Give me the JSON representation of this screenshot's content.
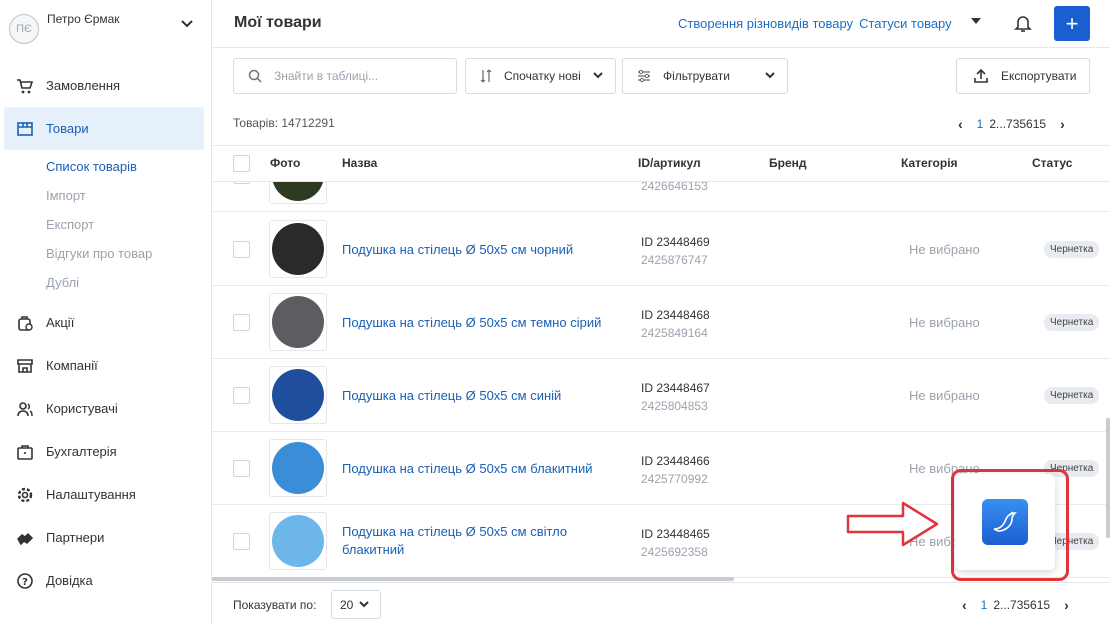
{
  "user": {
    "initials": "ПЄ",
    "name": "Петро Єрмак"
  },
  "sidebar": {
    "items": [
      {
        "label": "Замовлення",
        "icon": "cart-icon"
      },
      {
        "label": "Товари",
        "icon": "box-icon",
        "active": true
      },
      {
        "label": "Акції",
        "icon": "tag-icon"
      },
      {
        "label": "Компанії",
        "icon": "store-icon"
      },
      {
        "label": "Користувачі",
        "icon": "users-icon"
      },
      {
        "label": "Бухгалтерія",
        "icon": "wallet-icon"
      },
      {
        "label": "Налаштування",
        "icon": "gear-icon"
      },
      {
        "label": "Партнери",
        "icon": "handshake-icon"
      },
      {
        "label": "Довідка",
        "icon": "help-icon"
      }
    ],
    "sub_items": [
      "Список товарів",
      "Імпорт",
      "Експорт",
      "Відгуки про товар",
      "Дублі"
    ]
  },
  "header": {
    "title": "Мої товари",
    "link_variants": "Створення різновидів товару",
    "link_statuses": "Статуси товару",
    "plus": "+"
  },
  "toolbar": {
    "search_placeholder": "Знайти в таблиці...",
    "sort_label": "Спочатку нові",
    "filter_label": "Фільтрувати",
    "export_label": "Експортувати"
  },
  "count_label": "Товарів: 14712291",
  "pagination": {
    "current": "1",
    "rest": "2...735615"
  },
  "table": {
    "headers": {
      "photo": "Фото",
      "name": "Назва",
      "id": "ID/артикул",
      "brand": "Бренд",
      "category": "Категорія",
      "status": "Статус"
    },
    "partial_row": {
      "article": "2426646153",
      "color": "#2d3b22"
    },
    "rows": [
      {
        "name": "Подушка на стілець Ø 50х5 см чорний",
        "id": "ID 23448469",
        "article": "2425876747",
        "category": "Не вибрано",
        "status": "Чернетка",
        "color": "#2a2a2a"
      },
      {
        "name": "Подушка на стілець Ø 50х5 см темно сірий",
        "id": "ID 23448468",
        "article": "2425849164",
        "category": "Не вибрано",
        "status": "Чернетка",
        "color": "#5b5d60"
      },
      {
        "name": "Подушка на стілець Ø 50х5 см синій",
        "id": "ID 23448467",
        "article": "2425804853",
        "category": "Не вибрано",
        "status": "Чернетка",
        "color": "#1f4f9c"
      },
      {
        "name": "Подушка на стілець Ø 50х5 см блакитний",
        "id": "ID 23448466",
        "article": "2425770992",
        "category": "Не вибрано",
        "status": "Чернетка",
        "color": "#3a8ed8"
      },
      {
        "name": "Подушка на стілець Ø 50х5 см світло блакитний",
        "id": "ID 23448465",
        "article": "2425692358",
        "category": "Не вибрано",
        "status": "Чернетка",
        "color": "#6cb6ea"
      }
    ]
  },
  "footer": {
    "per_page_label": "Показувати по:",
    "per_page_value": "20"
  },
  "colors": {
    "accent": "#1a5fd0",
    "link": "#1a6fc4",
    "annotation": "#e0353d"
  }
}
